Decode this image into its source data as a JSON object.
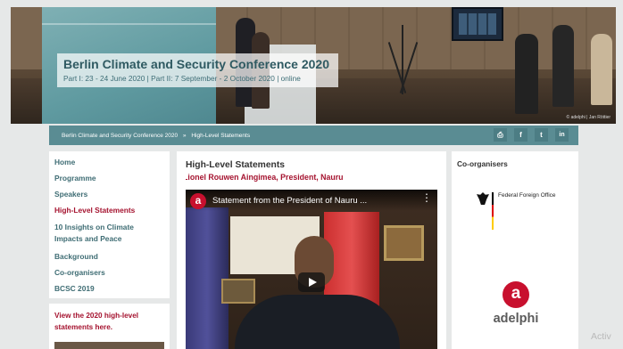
{
  "hero": {
    "title": "Berlin Climate and Security Conference 2020",
    "subtitle": "Part I: 23 - 24 June 2020 | Part II: 7 September - 2 October 2020 | online",
    "credit": "© adelphi | Jan Röttier"
  },
  "breadcrumb": {
    "items": [
      "Berlin Climate and Security Conference 2020",
      "»",
      "High-Level Statements"
    ]
  },
  "share": {
    "icons": [
      "print-icon",
      "facebook-icon",
      "twitter-icon",
      "linkedin-icon"
    ],
    "glyphs": [
      "⎙",
      "f",
      "t",
      "in"
    ]
  },
  "nav": {
    "items": [
      {
        "label": "Home",
        "active": false
      },
      {
        "label": "Programme",
        "active": false
      },
      {
        "label": "Speakers",
        "active": false
      },
      {
        "label": "High-Level Statements",
        "active": true
      },
      {
        "label": "10 Insights on Climate Impacts and Peace",
        "active": false
      },
      {
        "label": "Background",
        "active": false
      },
      {
        "label": "Co-organisers",
        "active": false
      },
      {
        "label": "BCSC 2019",
        "active": false
      }
    ]
  },
  "promo": {
    "text": "View the 2020 high-level statements here."
  },
  "main": {
    "heading": "High-Level Statements",
    "subtitle": "Lionel Rouwen Aingimea, President, Nauru",
    "video_title": "Statement from the President of Nauru ...",
    "menu_glyph": "⋮"
  },
  "sidebar": {
    "heading": "Co-organisers",
    "ffo_label": "Federal Foreign Office",
    "adelphi_word": "adelphi",
    "adelphi_letter": "a"
  },
  "watermark": "Activ",
  "colors": {
    "accent_red": "#a5132f",
    "teal": "#5a8c93",
    "nav_text": "#3f6d74",
    "adelphi_red": "#c8102e"
  }
}
